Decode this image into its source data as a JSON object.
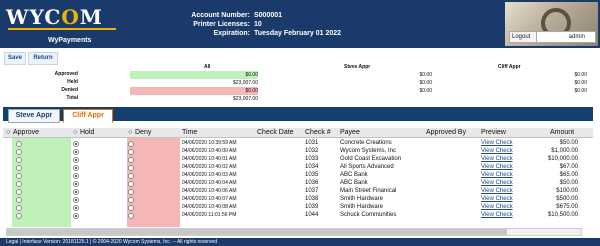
{
  "header": {
    "logo_prefix": "WYC",
    "logo_accent": "O",
    "logo_suffix": "M",
    "app_name": "WyPayments",
    "account_number_label": "Account Number:",
    "account_number": "S000001",
    "printer_licenses_label": "Printer Licenses:",
    "printer_licenses": "10",
    "expiration_label": "Expiration:",
    "expiration": "Tuesday February 01 2022",
    "logout_label": "Logout",
    "user": "admin"
  },
  "toolbar": {
    "save_label": "Save",
    "return_label": "Return"
  },
  "summary": {
    "columns": [
      "All",
      "Steve Appr",
      "Cliff Appr"
    ],
    "rows": [
      {
        "label": "Approved",
        "values": [
          "$0.00",
          "$0.00",
          "$0.00"
        ]
      },
      {
        "label": "Held",
        "values": [
          "$23,007.00",
          "$0.00",
          "$0.00"
        ]
      },
      {
        "label": "Denied",
        "values": [
          "$0.00",
          "$0.00",
          "$0.00"
        ]
      },
      {
        "label": "Total",
        "values": [
          "$23,007.00",
          "",
          ""
        ]
      }
    ]
  },
  "tabs": [
    {
      "label": "Steve Appr",
      "active": false
    },
    {
      "label": "Cliff Appr",
      "active": true
    }
  ],
  "table": {
    "headers": {
      "approve": "Approve",
      "hold": "Hold",
      "deny": "Deny",
      "time": "Time",
      "check_date": "Check Date",
      "check_num": "Check #",
      "payee": "Payee",
      "approved_by": "Approved By",
      "preview": "Preview",
      "amount": "Amount"
    },
    "rows": [
      {
        "time": "04/06/2020 10:39:59 AM",
        "check_num": "1031",
        "payee": "Concrete Creations",
        "preview": "View Check",
        "amount": "$50.00"
      },
      {
        "time": "04/06/2020 10:40:00 AM",
        "check_num": "1032",
        "payee": "Wycom Systems, Inc",
        "preview": "View Check",
        "amount": "$1,000.00"
      },
      {
        "time": "04/06/2020 10:40:01 AM",
        "check_num": "1033",
        "payee": "Gold Coast Excavation",
        "preview": "View Check",
        "amount": "$10,000.00"
      },
      {
        "time": "04/06/2020 10:40:02 AM",
        "check_num": "1034",
        "payee": "All Sports Advanced",
        "preview": "View Check",
        "amount": "$67.00"
      },
      {
        "time": "04/06/2020 10:40:03 AM",
        "check_num": "1035",
        "payee": "ABC Bank",
        "preview": "View Check",
        "amount": "$65.00"
      },
      {
        "time": "04/06/2020 10:40:04 AM",
        "check_num": "1036",
        "payee": "ABC Bank",
        "preview": "View Check",
        "amount": "$50.00"
      },
      {
        "time": "04/06/2020 10:40:06 AM",
        "check_num": "1037",
        "payee": "Main Street Finanical",
        "preview": "View Check",
        "amount": "$100.00"
      },
      {
        "time": "04/06/2020 10:40:07 AM",
        "check_num": "1038",
        "payee": "Smith Hardware",
        "preview": "View Check",
        "amount": "$500.00"
      },
      {
        "time": "04/06/2020 10:40:08 AM",
        "check_num": "1039",
        "payee": "Smith Hardware",
        "preview": "View Check",
        "amount": "$675.00"
      },
      {
        "time": "04/06/2020 11:01:56 PM",
        "check_num": "1044",
        "payee": "Schuck Communities",
        "preview": "View Check",
        "amount": "$10,500.00"
      }
    ]
  },
  "footer": {
    "text": "Legal | Interface Version: 20181125.1 | © 2004-2020 Wycom Systems, Inc. -- All rights reserved"
  },
  "colors": {
    "header_bg": "#1a3a6c",
    "approve_green": "#bff0b9",
    "deny_red": "#f5b6b6",
    "active_tab": "#e07000"
  }
}
